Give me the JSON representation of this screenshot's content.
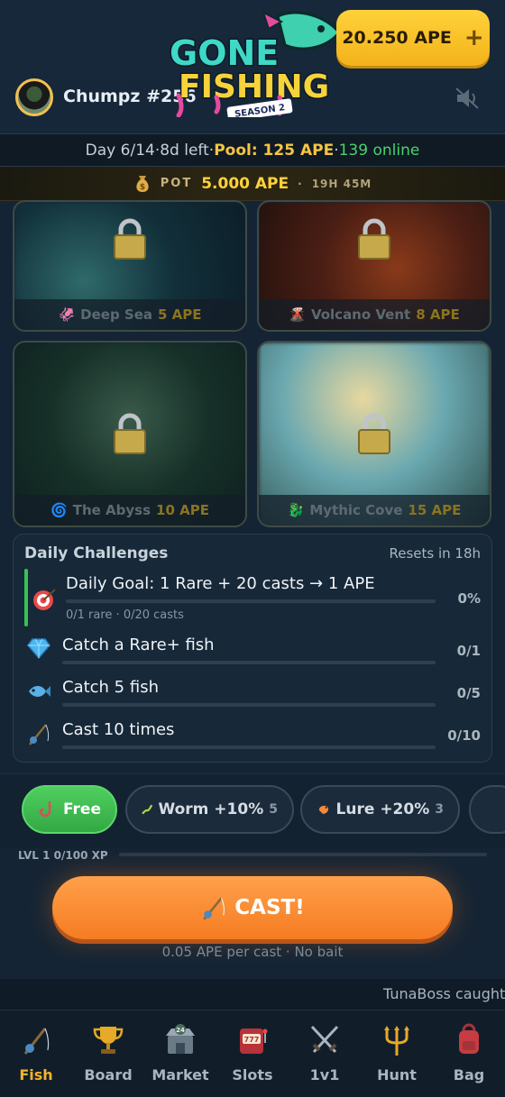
{
  "header": {
    "username": "Chumpz #256",
    "logo_line1": "GONE",
    "logo_line2": "FISHING",
    "logo_season": "SEASON 2",
    "balance": "20.250 APE",
    "balance_plus": "+"
  },
  "status": {
    "day": "Day 6/14",
    "left": "8d left",
    "pool_label": "Pool: 125 APE",
    "online": "139 online",
    "sep": " · "
  },
  "pot": {
    "label": "POT",
    "value": "5.000 APE",
    "sep": "·",
    "time": "19H 45M"
  },
  "locations": [
    {
      "name": "Deep Sea",
      "price": "5 APE",
      "icon": "squid-icon"
    },
    {
      "name": "Volcano Vent",
      "price": "8 APE",
      "icon": "volcano-icon"
    },
    {
      "name": "The Abyss",
      "price": "10 APE",
      "icon": "swirl-icon"
    },
    {
      "name": "Mythic Cove",
      "price": "15 APE",
      "icon": "dragon-icon"
    }
  ],
  "challenges": {
    "title": "Daily Challenges",
    "resets": "Resets in 18h",
    "items": [
      {
        "label": "Daily Goal: 1 Rare + 20 casts → 1 APE",
        "progress": "0%",
        "sub": "0/1 rare · 0/20 casts",
        "fill": 0
      },
      {
        "label": "Catch a Rare+ fish",
        "progress": "0/1",
        "fill": 0
      },
      {
        "label": "Catch 5 fish",
        "progress": "0/5",
        "fill": 0
      },
      {
        "label": "Cast 10 times",
        "progress": "0/10",
        "fill": 0
      }
    ]
  },
  "bait": [
    {
      "label": "Free",
      "count": ""
    },
    {
      "label": "Worm +10%",
      "count": "5"
    },
    {
      "label": "Lure +20%",
      "count": "3"
    }
  ],
  "xp": {
    "label": "LVL 1 0/100 XP",
    "fill": 0
  },
  "cast": {
    "label": "CAST!",
    "sub": "0.05 APE per cast · No bait"
  },
  "ticker": "TunaBoss caught",
  "nav": [
    {
      "label": "Fish",
      "active": true
    },
    {
      "label": "Board"
    },
    {
      "label": "Market",
      "badge": "24"
    },
    {
      "label": "Slots",
      "badge": "777"
    },
    {
      "label": "1v1"
    },
    {
      "label": "Hunt"
    },
    {
      "label": "Bag"
    }
  ],
  "colors": {
    "accent": "#f5b32a",
    "gold": "#ffd23a",
    "green": "#49d36b",
    "cast": "#f67c22",
    "bg": "#152434"
  }
}
